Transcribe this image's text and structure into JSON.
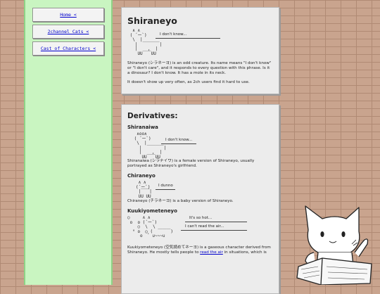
{
  "nav": [
    {
      "label": "Home <"
    },
    {
      "label": "2channel Cats <"
    },
    {
      "label": "Cast of Characters <"
    }
  ],
  "shiraneyo": {
    "title": "Shiraneyo",
    "speech": "I don't know...",
    "p1": "Shiraneyo (シラネーヨ) is an odd creature. Its name means \"I don't know\" or \"I don't care\", and it responds to every question with this phrase. Is it a dinosaur? I don't know. It has a mole in its neck.",
    "p2": "It doesn't show up very often, as 2ch users find it hard to use."
  },
  "derivatives": {
    "title": "Derivatives:",
    "shiranaiwa": {
      "title": "Shiranaiwa",
      "speech": "I don't know...",
      "text": "Shiranaiwa (シラナイワ) is a female version of Shiraneyo, usually portrayed as Shiraneyo's girlfriend."
    },
    "chiraneyo": {
      "title": "Chiraneyo",
      "speech": "I dunno",
      "text": "Chiraneyo (チラネーヨ) is a baby version of Shiraneyo."
    },
    "kuukiyometeneyo": {
      "title": "Kuukiyometeneyo",
      "speech1": "It's so hot...",
      "speech2": "I can't read the air...",
      "text_before": "Kuukiyometeneyo (空気読めてネーヨ) is a gaseous character derived from Shiraneyo. He mostly tells people to ",
      "link": "read the air",
      "text_after": " in situations, which is"
    }
  }
}
